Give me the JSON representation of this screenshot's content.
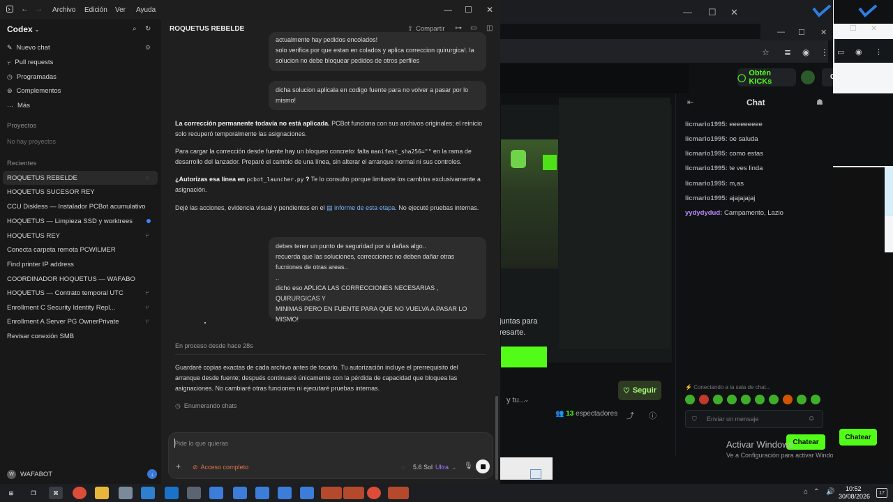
{
  "menubar": {
    "items": [
      "Archivo",
      "Edición",
      "Ver",
      "Ayuda"
    ]
  },
  "sidebar": {
    "brand": "Codex",
    "nav": [
      {
        "label": "Nuevo chat",
        "icon": "edit-icon"
      },
      {
        "label": "Pull requests",
        "icon": "pull-request-icon"
      },
      {
        "label": "Programadas",
        "icon": "clock-icon"
      },
      {
        "label": "Complementos",
        "icon": "plugin-icon"
      },
      {
        "label": "Más",
        "icon": "more-icon"
      }
    ],
    "projects_title": "Proyectos",
    "projects_empty": "No hay proyectos",
    "recent_title": "Recientes",
    "recent": [
      "ROQUETUS REBELDE",
      "HOQUETUS SUCESOR REY",
      "CCU Diskless — Instalador PCBot acumulativo",
      "HOQUETUS — Limpieza SSD y worktrees",
      "HOQUETUS REY",
      "Conecta carpeta remota PCWILMER",
      "Find printer IP address",
      "COORDINADOR HOQUETUS — WAFABO",
      "HOQUETUS — Contrato temporal UTC",
      "Enrollment C Security Identity Repl...",
      "Enrollment A Server PG OwnerPrivate",
      "Revisar conexión SMB"
    ],
    "user": "WAFABOT",
    "avatar_text": "W"
  },
  "main": {
    "title": "ROQUETUS REBELDE",
    "more": "···",
    "share": "Compartir",
    "bubble1": {
      "l1": "actualmente hay pedidos encolados!",
      "l2": "solo verifica por que estan en colados y aplica correccion quirurgica!. la",
      "l3": "solucion no debe bloquear pedidos de otros perfiles"
    },
    "bubble2": {
      "l1": "dicha solucion aplicala en codigo fuente para no volver a pasar por lo",
      "l2": "mismo!"
    },
    "reply1": {
      "bold": "La corrección permanente todavía no está aplicada.",
      "rest1": " PCBot funciona con sus archivos originales; el reinicio",
      "l2": "solo recuperó temporalmente las asignaciones."
    },
    "reply2": {
      "pre": "Para cargar la corrección desde fuente hay un bloqueo concreto: falta ",
      "code": "manifest_sha256=\"\"",
      "post": " en la rama de",
      "l2": "desarrollo del lanzador. Preparé el cambio de una línea, sin alterar el arranque normal ni sus controles."
    },
    "reply3": {
      "bold": "¿Autorizas esa línea en ",
      "code": "pcbot_launcher.py",
      "bold2": " ?",
      "rest": " Te lo consulto porque limitaste los cambios exclusivamente a",
      "l2": "asignación."
    },
    "reply4": {
      "pre": "Dejé las acciones, evidencia visual y pendientes en el ",
      "link": "informe de esta etapa",
      "post": ". No ejecuté pruebas internas."
    },
    "bubble3": {
      "l1": "debes tener un punto de seguridad por si dañas algo..",
      "l2": "recuerda que las soluciones, correcciones no deben dañar otras",
      "l3": "fucniones de otras areas..",
      "l4": "..",
      "l5": "dicho eso APLICA LAS CORRECCIONES NECESARIAS , QUIRURGICAS Y",
      "l6": "MINIMAS PERO EN FUENTE PARA QUE NO VUELVA A PASAR LO",
      "l7": "MISMO!"
    },
    "progress": "En proceso desde hace 28s",
    "reply5": {
      "l1": "Guardaré copias exactas de cada archivo antes de tocarlo. Tu autorización incluye el prerrequisito del",
      "l2": "arranque desde fuente; después continuaré únicamente con la pérdida de capacidad que bloquea las",
      "l3": "asignaciones. No cambiaré otras funciones ni ejecutaré pruebas internas."
    },
    "activity": "Enumerando chats",
    "composer": {
      "placeholder": "Pide lo que quieras",
      "access": "Acceso completo",
      "model": "5.6 Sol",
      "model_tier": "Ultra"
    }
  },
  "background": {
    "kick_button": "Obtén KICKs",
    "kick_partial": "Cks",
    "chat_title": "Chat",
    "chat_messages": [
      {
        "user": "licmario1995:",
        "text": " eeeeeeeee"
      },
      {
        "user": "licmario1995:",
        "text": " oe saluda"
      },
      {
        "user": "licmario1995:",
        "text": " como estas"
      },
      {
        "user": "licmario1995:",
        "text": " te ves linda"
      },
      {
        "user": "licmario1995:",
        "text": " m,as"
      },
      {
        "user": "licmario1995:",
        "text": " ajajajajaj"
      },
      {
        "user": "yydydydud:",
        "text": " Campamento, Lazio"
      }
    ],
    "connecting": "Conectando a la sala de chat...",
    "chat_placeholder": "Enviar un mensaje",
    "chatear": "Chatear",
    "seguir": "Seguir",
    "spectators_count": "13",
    "spectators_label": "espectadores",
    "modal_l1": "juntas para",
    "modal_l2": "resarte.",
    "stream_title_partial": "y tu...",
    "activar_title": "Activar Windows",
    "activar_sub": "Ve a Configuración para activar Windows."
  },
  "taskbar": {
    "time": "10:52",
    "date": "30/08/2026",
    "notif": "17"
  },
  "colors": {
    "kick_green": "#53fc18",
    "link_blue": "#7ab4ff",
    "access_orange": "#e0734a",
    "ultra_purple": "#9b7bff"
  }
}
